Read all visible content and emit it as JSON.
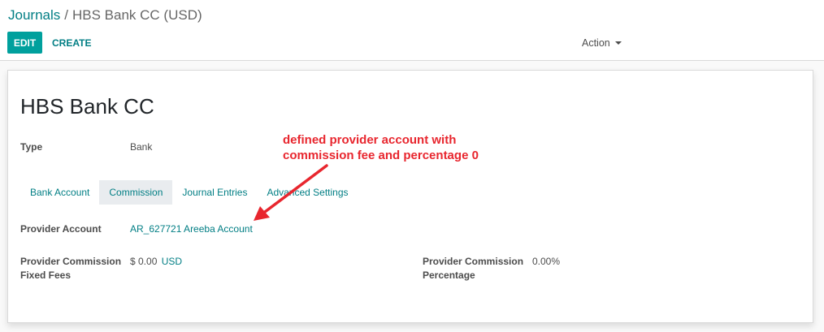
{
  "breadcrumb": {
    "parent": "Journals",
    "separator": "/",
    "current": "HBS Bank CC (USD)"
  },
  "toolbar": {
    "edit_label": "EDIT",
    "create_label": "CREATE",
    "action_label": "Action"
  },
  "record": {
    "title": "HBS Bank CC",
    "type_label": "Type",
    "type_value": "Bank"
  },
  "tabs": [
    {
      "label": "Bank Account",
      "active": false
    },
    {
      "label": "Commission",
      "active": true
    },
    {
      "label": "Journal Entries",
      "active": false
    },
    {
      "label": "Advanced Settings",
      "active": false
    }
  ],
  "commission": {
    "provider_account_label": "Provider Account",
    "provider_account_value": "AR_627721 Areeba Account",
    "fixed_fees_label_line1": "Provider Commission",
    "fixed_fees_label_line2": "Fixed Fees",
    "fixed_fees_amount": "$ 0.00",
    "fixed_fees_currency": "USD",
    "percentage_label_line1": "Provider Commission",
    "percentage_label_line2": "Percentage",
    "percentage_value": "0.00%"
  },
  "annotation": {
    "line1": "defined provider account with",
    "line2": "commission fee and percentage 0",
    "color": "#e8262e"
  },
  "colors": {
    "brand_primary": "#00a09d",
    "link": "#017e84",
    "text": "#4c4c4c"
  }
}
